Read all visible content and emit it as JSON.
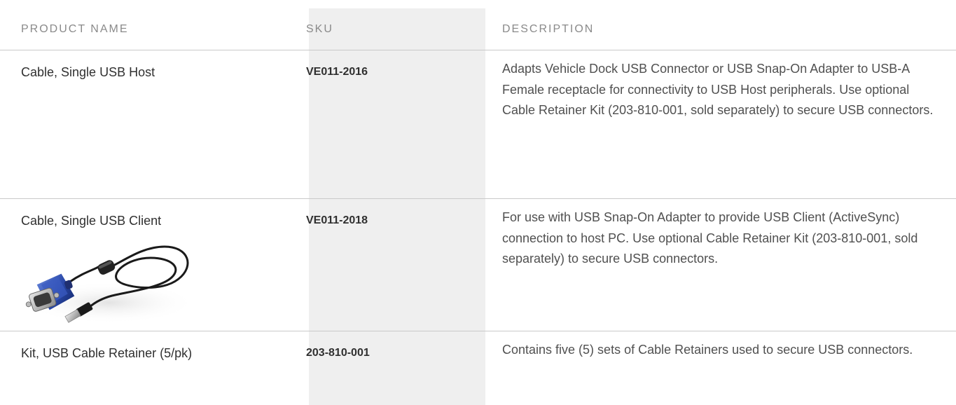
{
  "table": {
    "headers": {
      "product_name": "PRODUCT NAME",
      "sku": "SKU",
      "description": "DESCRIPTION"
    },
    "rows": [
      {
        "product_name": "Cable, Single USB Host",
        "sku": "VE011-2016",
        "description": "Adapts Vehicle Dock USB Connector or USB Snap-On Adapter to USB-A Female receptacle for connectivity to USB Host peripherals. Use optional Cable Retainer Kit (203-810-001, sold separately) to secure USB connectors."
      },
      {
        "product_name": "Cable, Single USB Client",
        "sku": "VE011-2018",
        "description": "For use with USB Snap-On Adapter to provide USB Client (ActiveSync) connection to host PC. Use optional Cable Retainer Kit (203-810-001, sold separately) to secure USB connectors.",
        "image": "usb-cable-with-blue-db9-connector"
      },
      {
        "product_name": "Kit, USB Cable Retainer (5/pk)",
        "sku": "203-810-001",
        "description": "Contains five (5) sets of Cable Retainers used to secure USB connectors."
      }
    ]
  },
  "colors": {
    "sku_column_bg": "#efefef",
    "header_text": "#8a8a8a",
    "body_text": "#303030",
    "divider": "#c9c9c9"
  }
}
